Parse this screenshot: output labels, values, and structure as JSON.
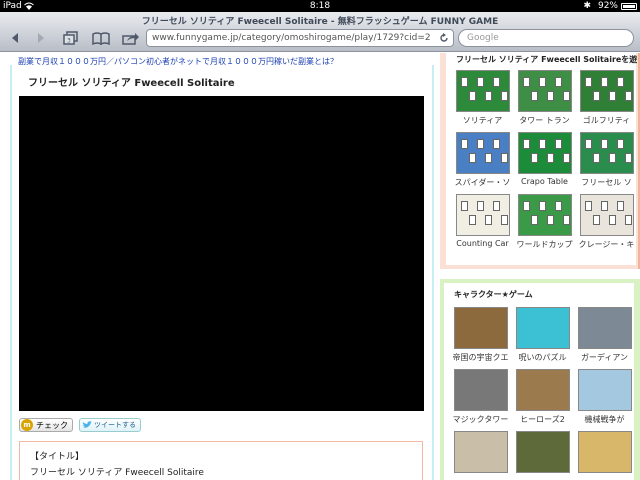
{
  "status": {
    "device": "iPad",
    "time": "8:18",
    "battery": "92%"
  },
  "browser": {
    "page_title": "フリーセル ソリティア Fweecell Solitaire - 無料フラッシュゲーム FUNNY GAME",
    "url": "www.funnygame.jp/category/omoshirogame/play/1729?cid=2",
    "search_placeholder": "Google"
  },
  "page": {
    "top_link": "副業で月収１０００万円／パソコン初心者がネットで月収１０００万円稼いだ副業とは？",
    "game_title": "フリーセル ソリティア Fweecell Solitaire",
    "check_label": "チェック",
    "tweet_label": "ツイートする",
    "info_heading": "【タイトル】",
    "info_title": "フリーセル ソリティア Fweecell Solitaire"
  },
  "sidebar": {
    "panel1_title": "フリーセル ソリティア Fweecell Solitaireを遊",
    "panel1_items": [
      {
        "label": "ソリティア",
        "color": "#2d8a3a"
      },
      {
        "label": "タワー トラン",
        "color": "#3f8e45"
      },
      {
        "label": "ゴルフリティ",
        "color": "#2f7f37"
      },
      {
        "label": "スパイダー・ソ",
        "color": "#4a7fc4"
      },
      {
        "label": "Crapo Table",
        "color": "#1d8c3a"
      },
      {
        "label": "フリーセル ソ",
        "color": "#2a8c4d"
      },
      {
        "label": "Counting Car",
        "color": "#f1efe4"
      },
      {
        "label": "ワールドカップ",
        "color": "#3a9a48"
      },
      {
        "label": "クレージー・キ",
        "color": "#e9e4dc"
      }
    ],
    "panel2_title": "キャラクター★ゲーム",
    "panel2_items": [
      {
        "label": "帝国の宇宙クエ",
        "color": "#8d6a3e"
      },
      {
        "label": "呪いのパズル",
        "color": "#3bc0d4"
      },
      {
        "label": "ガーディアン",
        "color": "#7d8a96"
      },
      {
        "label": "マジックタワー",
        "color": "#787878"
      },
      {
        "label": "ヒーローズ2",
        "color": "#9b7a4e"
      },
      {
        "label": "機械戦争が",
        "color": "#a4c8e0"
      },
      {
        "label": "",
        "color": "#c9bfa8"
      },
      {
        "label": "",
        "color": "#5e6a3a"
      },
      {
        "label": "",
        "color": "#d9b76a"
      }
    ]
  }
}
